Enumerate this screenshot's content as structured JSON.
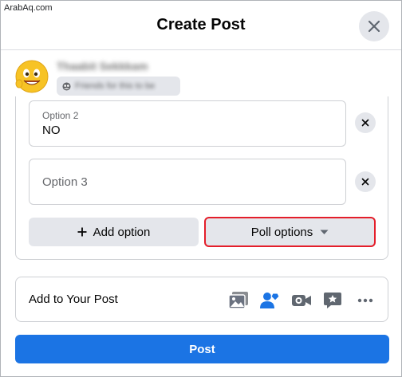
{
  "watermark": "ArabAq.com",
  "header": {
    "title": "Create Post"
  },
  "author": {
    "name": "Thaabit Sekkkam",
    "audience": "Friends for this to be"
  },
  "poll": {
    "options": [
      {
        "label": "Option 2",
        "value": "NO"
      },
      {
        "placeholder": "Option 3",
        "value": ""
      }
    ],
    "add_option_label": "Add option",
    "poll_options_label": "Poll options"
  },
  "add_to_post": {
    "label": "Add to Your Post",
    "icons": [
      "photo-video-icon",
      "tag-people-icon",
      "live-video-icon",
      "feeling-icon",
      "more-icon"
    ]
  },
  "post_button": {
    "label": "Post"
  },
  "colors": {
    "primary": "#1b74e4",
    "highlight_border": "#e41e2a",
    "photo_icon": "#6b7280",
    "tag_icon": "#1b74e4",
    "secondary_icon": "#606770"
  }
}
